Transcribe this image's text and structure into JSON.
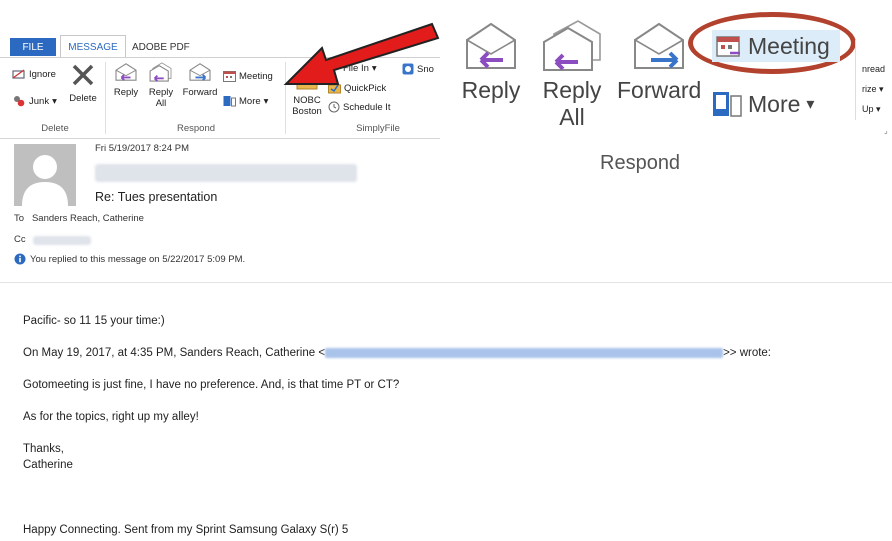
{
  "tabs": {
    "file": "FILE",
    "message": "MESSAGE",
    "adobe": "ADOBE PDF"
  },
  "ribbon": {
    "ignore": "Ignore",
    "junk": "Junk",
    "delete": "Delete",
    "reply": "Reply",
    "reply_all_1": "Reply",
    "reply_all_2": "All",
    "forward": "Forward",
    "meeting": "Meeting",
    "more": "More",
    "nobc_1": "NOBC",
    "nobc_2": "Boston",
    "file_in": "File In",
    "quickpick": "QuickPick",
    "schedule_it": "Schedule It",
    "snd": "Sno",
    "group_delete": "Delete",
    "group_respond": "Respond",
    "group_simplyfile": "SimplyFile"
  },
  "zoom": {
    "reply": "Reply",
    "reply_all_1": "Reply",
    "reply_all_2": "All",
    "forward": "Forward",
    "meeting": "Meeting",
    "more": "More",
    "group_respond": "Respond",
    "right_items": [
      "nread",
      "rize",
      "Up"
    ]
  },
  "message": {
    "date": "Fri 5/19/2017 8:24 PM",
    "subject": "Re: Tues presentation",
    "to_label": "To",
    "to_value": "Sanders Reach, Catherine",
    "cc_label": "Cc",
    "replied_notice": "You replied to this message on 5/22/2017 5:09 PM."
  },
  "body": {
    "line1": "Pacific- so 11 15 your time:)",
    "line2_prefix": "On May 19, 2017, at 4:35 PM, Sanders Reach, Catherine <",
    "line2_suffix": ">> wrote:",
    "line3": "Gotomeeting is just fine, I have no preference. And, is that time PT or CT?",
    "line4": "As for the topics, right up my alley!",
    "line5": "Thanks,",
    "line6": "Catherine",
    "line7": "Happy Connecting. Sent from my Sprint Samsung Galaxy S(r) 5"
  },
  "colors": {
    "accent": "#2b6ac0",
    "arrow": "#e21b1b",
    "highlight_ring": "#b2422e",
    "reply_arrow": "#8b4dbf",
    "forward_arrow": "#3a74c9"
  }
}
